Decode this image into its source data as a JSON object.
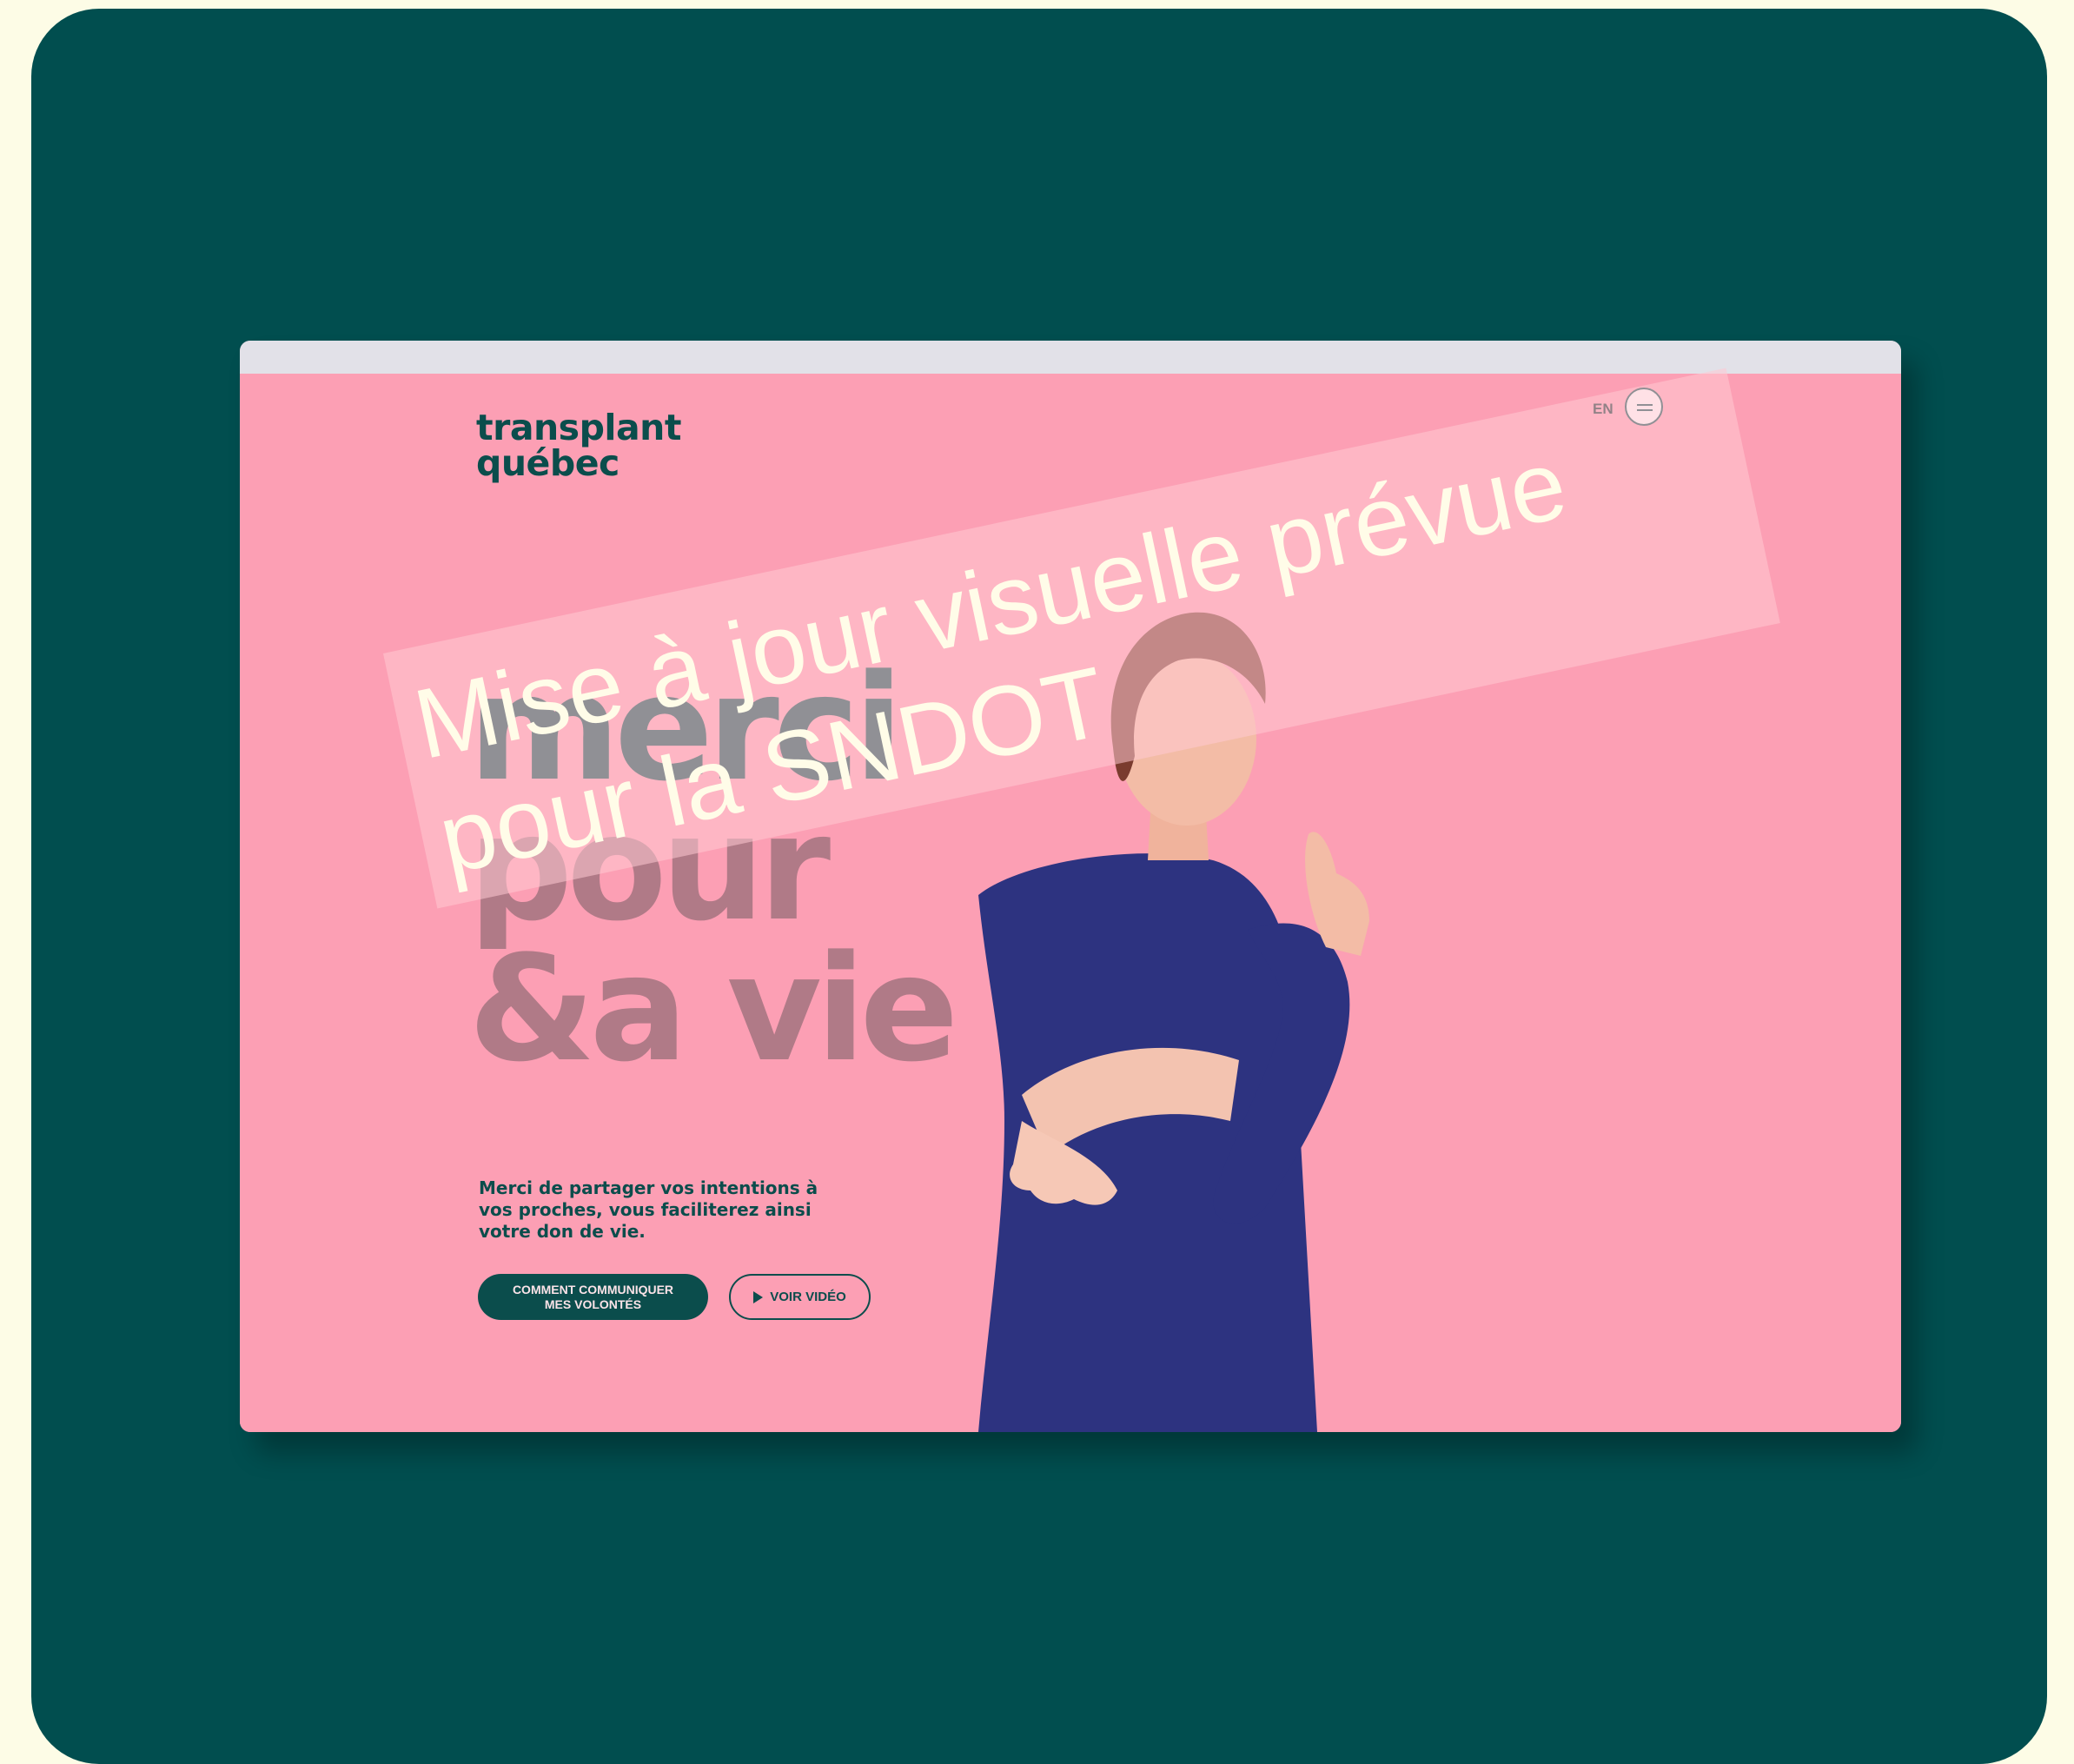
{
  "site": {
    "logo_line1": "transplant",
    "logo_line2": "québec",
    "lang_label": "EN",
    "headline": {
      "line1": "merci",
      "line2": "pour",
      "line3": "&a vie"
    },
    "subtitle": "Merci de partager vos intentions à vos proches, vous faciliterez ainsi votre don de vie.",
    "primary_button": {
      "line1": "COMMENT COMMUNIQUER",
      "line2": "MES VOLONTÉS"
    },
    "secondary_button_label": "VOIR VIDÉO"
  },
  "overlay": {
    "line1": "Mise à jour visuelle prévue",
    "line2": "pour la SNDOT"
  },
  "colors": {
    "background": "#fdfce6",
    "card": "#014e4f",
    "site_pink": "#fc9fb4",
    "brand_green": "#0b4d4c",
    "sweater": "#2d3380"
  },
  "icons": {
    "menu": "hamburger-icon",
    "play": "play-icon"
  }
}
